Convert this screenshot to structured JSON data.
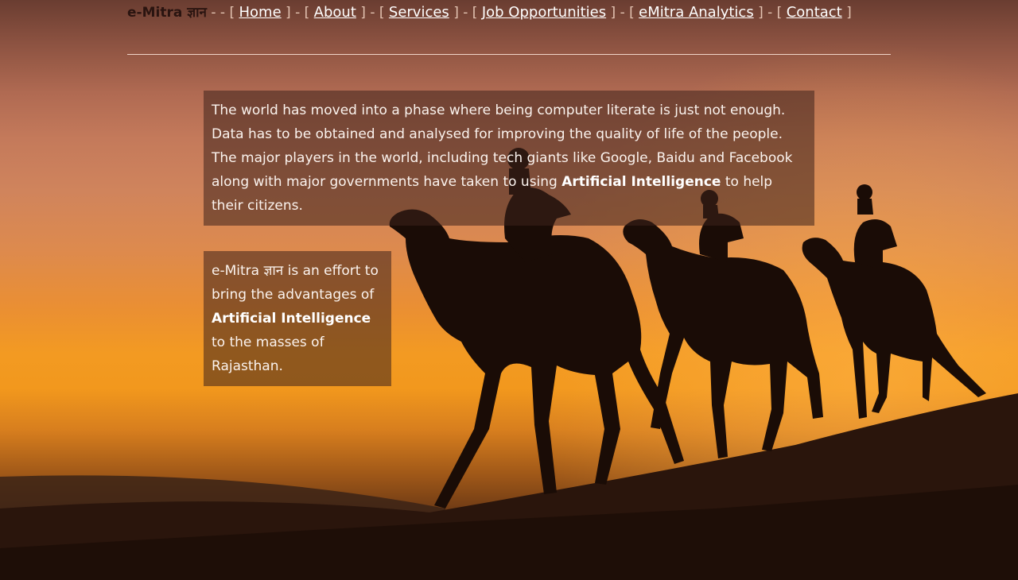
{
  "nav": {
    "brand": "e-Mitra ज्ञान",
    "lead_sep": " - - [ ",
    "links": [
      {
        "label": "Home"
      },
      {
        "label": "About"
      },
      {
        "label": "Services"
      },
      {
        "label": "Job Opportunities"
      },
      {
        "label": "eMitra Analytics"
      },
      {
        "label": "Contact"
      }
    ],
    "mid_sep": " ] - [ ",
    "end_sep": " ]"
  },
  "intro": {
    "text_before": "The world has moved into a phase where being computer literate is just not enough. Data has to be obtained and analysed for improving the quality of life of the people. The major players in the world, including tech giants like Google, Baidu and Facebook along with major governments have taken to using ",
    "highlight": "Artificial Intelligence",
    "text_after": " to help their citizens."
  },
  "mission": {
    "text_before": "e-Mitra ज्ञान is an effort to bring the advantages of ",
    "highlight": "Artificial Intelligence",
    "text_after": " to the masses of Rajasthan."
  },
  "background": {
    "icon": "camel-caravan-sunset-image"
  }
}
